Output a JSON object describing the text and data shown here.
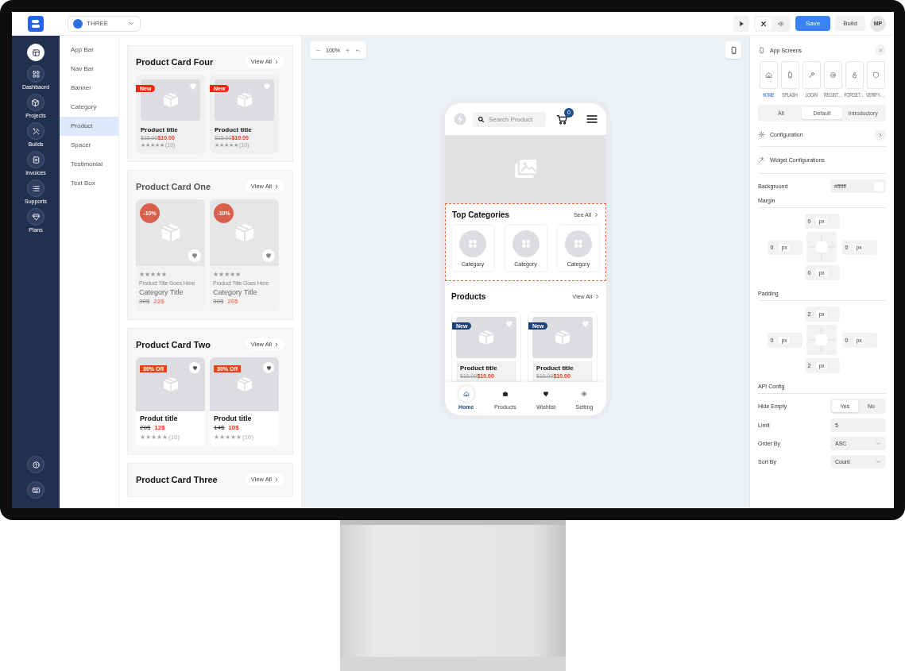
{
  "topbar": {
    "project": "THREE",
    "tool_toggles": [
      {
        "kind": "cross",
        "selected": true
      },
      {
        "kind": "eye",
        "selected": false
      }
    ],
    "save": "Save",
    "build": "Build",
    "avatar": "MP"
  },
  "nav": {
    "items": [
      {
        "kind": "layout",
        "selected": true
      },
      {
        "kind": "grid",
        "label": "Dashbaord",
        "selected": false
      },
      {
        "kind": "cube",
        "label": "Projects",
        "selected": false
      },
      {
        "kind": "tools",
        "label": "Builds",
        "selected": false
      },
      {
        "kind": "invoice",
        "label": "Invoices",
        "selected": false
      },
      {
        "kind": "list",
        "label": "Supports",
        "selected": false
      },
      {
        "kind": "gem",
        "label": "Plans",
        "selected": false
      }
    ],
    "bottom": [
      {
        "kind": "help"
      },
      {
        "kind": "keyboard"
      }
    ]
  },
  "widgets": [
    {
      "label": "App Bar",
      "selected": false
    },
    {
      "label": "Nav Bar",
      "selected": false
    },
    {
      "label": "Banner",
      "selected": false
    },
    {
      "label": "Category",
      "selected": false
    },
    {
      "label": "Product",
      "selected": true
    },
    {
      "label": "Spacer",
      "selected": false
    },
    {
      "label": "Testimonial",
      "selected": false
    },
    {
      "label": "Text Box",
      "selected": false
    }
  ],
  "sections": [
    {
      "kind": "four",
      "title": "Product Card Four",
      "view_all": "View All",
      "cards": [
        {
          "badge": "New",
          "title": "Product title",
          "old_price": "$15.00",
          "price": "$10.00",
          "rating": "★★★★★",
          "reviews": "(10)"
        },
        {
          "badge": "New",
          "title": "Product title",
          "old_price": "$15.00",
          "price": "$10.00",
          "rating": "★★★★★",
          "reviews": "(10)"
        }
      ]
    },
    {
      "kind": "one",
      "title": "Product Card One",
      "view_all": "View All",
      "cards": [
        {
          "badge": "-10%",
          "rating": "★★★★★",
          "subtitle": "Product Title Goes Here",
          "title": "Category Title",
          "old_price": "30$",
          "price": "22$"
        },
        {
          "badge": "-10%",
          "rating": "★★★★★",
          "subtitle": "Product Title Goes Here",
          "title": "Category Title",
          "old_price": "30$",
          "price": "20$"
        }
      ]
    },
    {
      "kind": "two",
      "title": "Product Card Two",
      "view_all": "View All",
      "cards": [
        {
          "badge": "30% Off",
          "title": "Produt title",
          "old_price": "20$",
          "price": "12$",
          "rating": "★★★★★",
          "reviews": "(10)"
        },
        {
          "badge": "30% Off",
          "title": "Produt title",
          "old_price": "14$",
          "price": "10$",
          "rating": "★★★★★",
          "reviews": "(10)"
        }
      ]
    },
    {
      "kind": "three",
      "title": "Product Card Three",
      "view_all": "View All"
    }
  ],
  "canvas": {
    "zoom": "100%"
  },
  "phone": {
    "search_placeholder": "Search Product",
    "cart_count": "0",
    "categories": {
      "title": "Top Categories",
      "see_all": "See All",
      "items": [
        "Category",
        "Category",
        "Category"
      ]
    },
    "products": {
      "title": "Products",
      "view_all": "View All",
      "cards": [
        {
          "badge": "New",
          "title": "Product title",
          "old_price": "$15.00",
          "price": "$10.00"
        },
        {
          "badge": "New",
          "title": "Product title",
          "old_price": "$15.00",
          "price": "$10.00"
        }
      ]
    },
    "bottom_nav": [
      {
        "kind": "home",
        "label": "Home",
        "selected": true
      },
      {
        "kind": "bag",
        "label": "Products",
        "selected": false
      },
      {
        "kind": "heart",
        "label": "Wishlist",
        "selected": false
      },
      {
        "kind": "gear",
        "label": "Setting",
        "selected": false
      }
    ]
  },
  "panel": {
    "title": "App Screens",
    "screens": [
      {
        "kind": "home",
        "label": "HOME",
        "selected": true
      },
      {
        "kind": "device",
        "label": "SPLASH",
        "selected": false
      },
      {
        "kind": "key",
        "label": "LOGIN",
        "selected": false
      },
      {
        "kind": "login",
        "label": "REGIST…",
        "selected": false
      },
      {
        "kind": "lock",
        "label": "FORGET…",
        "selected": false
      },
      {
        "kind": "shield",
        "label": "VERIFY-…",
        "selected": false
      }
    ],
    "filters": [
      {
        "label": "All",
        "selected": false
      },
      {
        "label": "Default",
        "selected": true
      },
      {
        "label": "Introductory",
        "selected": false
      }
    ],
    "configuration": "Configuration",
    "widget_config": "Widget Configurations",
    "background": {
      "label": "Background",
      "value": "#ffffff"
    },
    "margin": {
      "label": "Margin",
      "top": {
        "value": "0",
        "unit": "px"
      },
      "left": {
        "value": "0",
        "unit": "px"
      },
      "right": {
        "value": "0",
        "unit": "px"
      },
      "bottom": {
        "value": "0",
        "unit": "px"
      }
    },
    "padding": {
      "label": "Padding",
      "top": {
        "value": "2",
        "unit": "px"
      },
      "left": {
        "value": "0",
        "unit": "px"
      },
      "right": {
        "value": "0",
        "unit": "px"
      },
      "bottom": {
        "value": "2",
        "unit": "px"
      }
    },
    "api": {
      "title": "API Config",
      "hide_empty": {
        "label": "Hide Empty",
        "options": [
          {
            "label": "Yes",
            "selected": true
          },
          {
            "label": "No",
            "selected": false
          }
        ]
      },
      "limit": {
        "label": "Limit",
        "value": "5"
      },
      "order_by": {
        "label": "Order By",
        "value": "ASC"
      },
      "sort_by": {
        "label": "Sort By",
        "value": "Count"
      }
    }
  }
}
